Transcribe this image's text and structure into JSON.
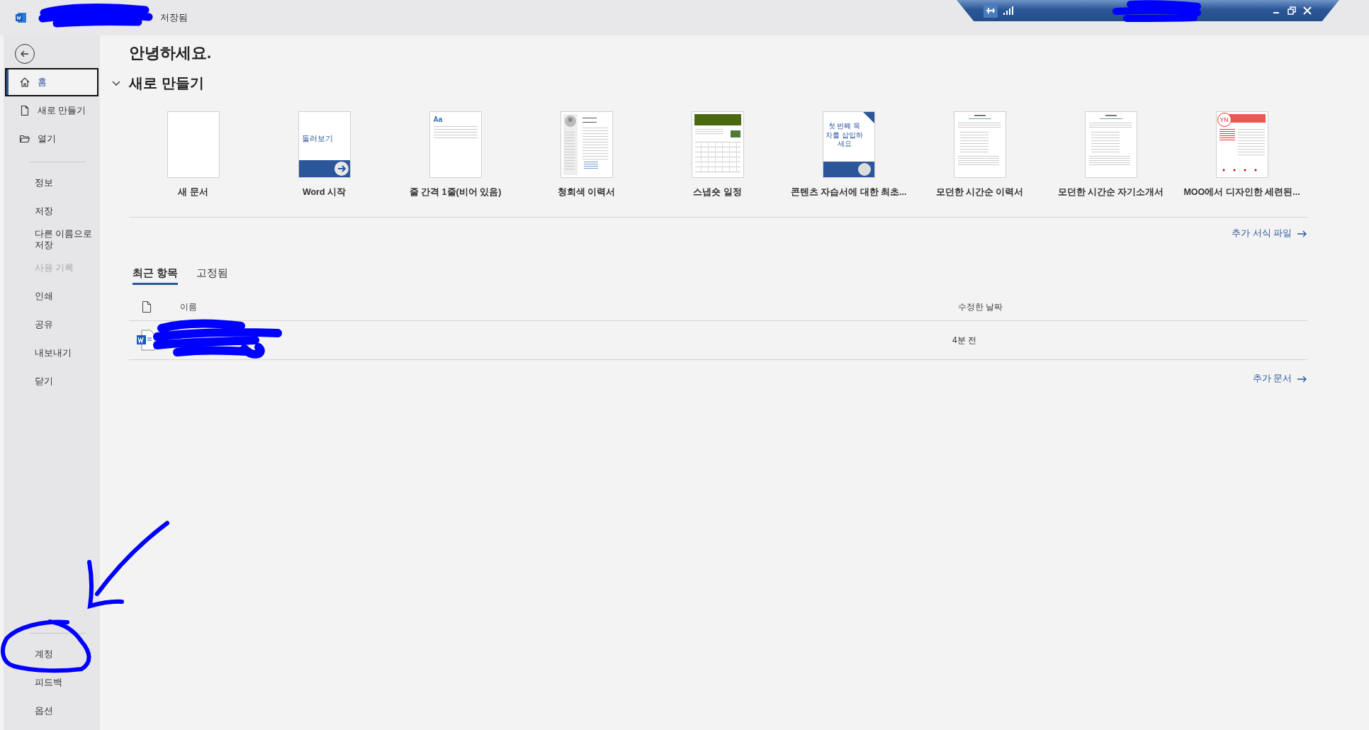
{
  "title_bar": {
    "status": "저장됨"
  },
  "sidebar": {
    "top_items": [
      {
        "label": "홈",
        "selected": true
      },
      {
        "label": "새로 만들기",
        "selected": false
      },
      {
        "label": "열기",
        "selected": false
      }
    ],
    "items": [
      {
        "label": "정보",
        "disabled": false
      },
      {
        "label": "저장",
        "disabled": false
      },
      {
        "label": "다른 이름으로 저장",
        "disabled": false
      },
      {
        "label": "사용 기록",
        "disabled": true
      },
      {
        "label": "인쇄",
        "disabled": false
      },
      {
        "label": "공유",
        "disabled": false
      },
      {
        "label": "내보내기",
        "disabled": false
      },
      {
        "label": "닫기",
        "disabled": false
      }
    ],
    "bottom_items": [
      {
        "label": "계정"
      },
      {
        "label": "피드백"
      },
      {
        "label": "옵션"
      }
    ]
  },
  "greeting": "안녕하세요.",
  "new_section": {
    "title": "새로 만들기",
    "expanded": true,
    "templates": [
      {
        "label": "새 문서",
        "kind": "blank"
      },
      {
        "label": "Word 시작",
        "kind": "tour",
        "thumb_text": "둘러보기"
      },
      {
        "label": "줄 간격 1줄(비어 있음)",
        "kind": "spacing",
        "thumb_text": "Aa"
      },
      {
        "label": "청회색 이력서",
        "kind": "photo-resume"
      },
      {
        "label": "스냅숏 일정",
        "kind": "calendar"
      },
      {
        "label": "콘텐츠 자습서에 대한 최초...",
        "kind": "toc",
        "thumb_text": "첫 번째 목차를 삽입하세요"
      },
      {
        "label": "모던한 시간순 이력서",
        "kind": "text-doc"
      },
      {
        "label": "모던한 시간순 자기소개서",
        "kind": "text-doc"
      },
      {
        "label": "MOO에서 디자인한 세련된...",
        "kind": "red-resume",
        "thumb_text": "YN"
      }
    ],
    "more_link": "추가 서식 파일"
  },
  "recent": {
    "tabs": [
      {
        "label": "최근 항목",
        "selected": true
      },
      {
        "label": "고정됨",
        "selected": false
      }
    ],
    "columns": [
      "이름",
      "수정한 날짜"
    ],
    "rows": [
      {
        "modified": "4분 전"
      }
    ],
    "more_link": "추가 문서"
  }
}
